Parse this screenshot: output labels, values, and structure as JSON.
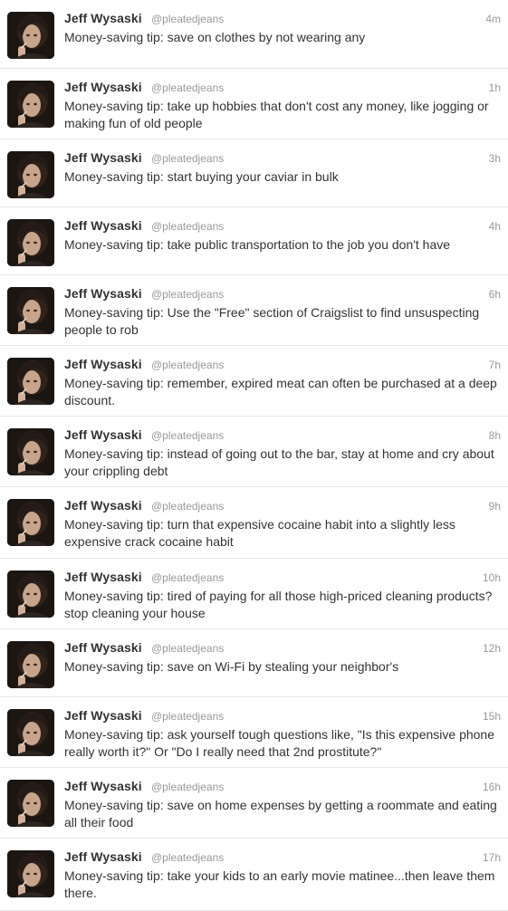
{
  "author": {
    "name": "Jeff Wysaski",
    "handle": "@pleatedjeans",
    "avatar_icon": "profile-photo"
  },
  "tweets": [
    {
      "time": "4m",
      "text": "Money-saving tip: save on clothes by not wearing any"
    },
    {
      "time": "1h",
      "text": "Money-saving tip: take up hobbies that don't cost any money, like jogging or making fun of old people"
    },
    {
      "time": "3h",
      "text": "Money-saving tip: start buying your caviar in bulk"
    },
    {
      "time": "4h",
      "text": "Money-saving tip: take public transportation to the job you don't have"
    },
    {
      "time": "6h",
      "text": "Money-saving tip: Use the \"Free\" section of Craigslist to find unsuspecting people to rob"
    },
    {
      "time": "7h",
      "text": "Money-saving tip: remember, expired meat can often be purchased at a deep discount."
    },
    {
      "time": "8h",
      "text": "Money-saving tip: instead of going out to the bar, stay at home and cry about your crippling debt"
    },
    {
      "time": "9h",
      "text": "Money-saving tip: turn that expensive cocaine habit into a slightly less expensive crack cocaine habit"
    },
    {
      "time": "10h",
      "text": "Money-saving tip: tired of paying for all those high-priced cleaning products? stop cleaning your house"
    },
    {
      "time": "12h",
      "text": "Money-saving tip: save on Wi-Fi by stealing your neighbor's"
    },
    {
      "time": "15h",
      "text": "Money-saving tip: ask yourself tough questions like, \"Is this expensive phone really worth it?\" Or \"Do I really need that 2nd prostitute?\""
    },
    {
      "time": "16h",
      "text": "Money-saving tip: save on home expenses by getting a roommate and eating all their food"
    },
    {
      "time": "17h",
      "text": "Money-saving tip: take your kids to an early movie matinee...then leave them there."
    }
  ]
}
